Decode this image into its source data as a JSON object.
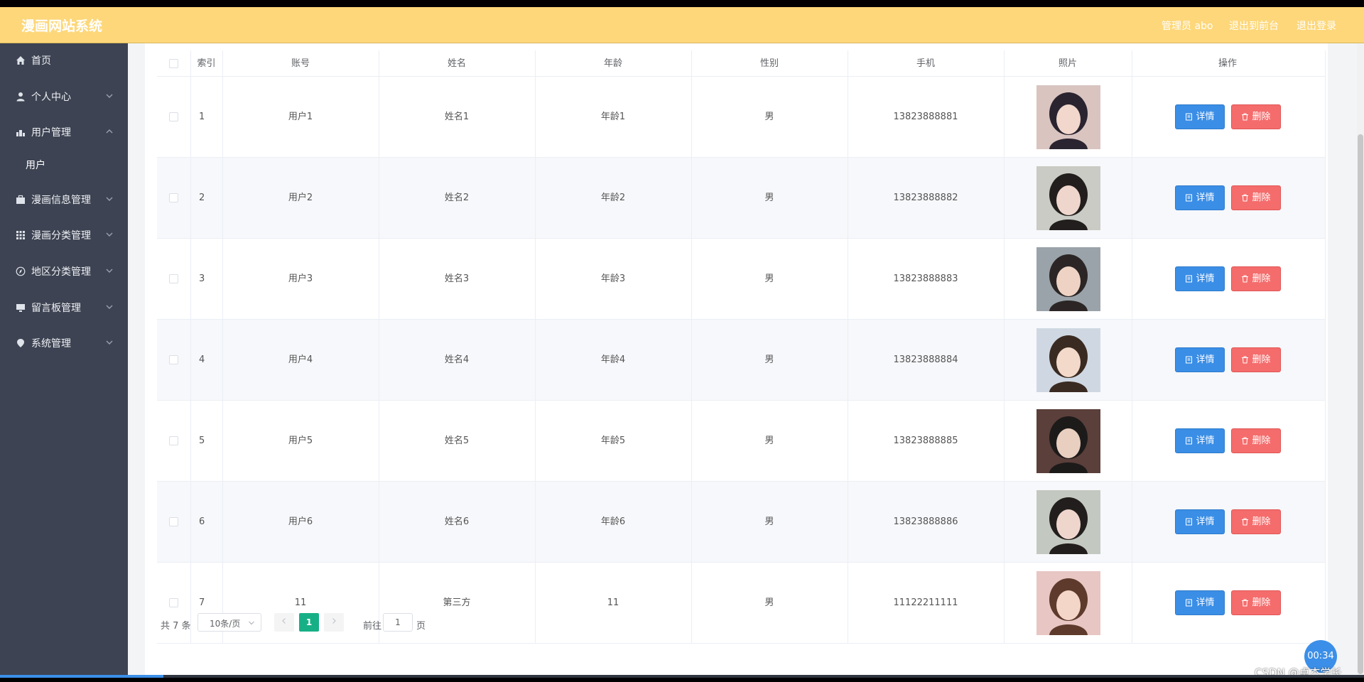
{
  "header": {
    "app_title": "漫画网站系统",
    "admin_label": "管理员 abo",
    "to_front": "退出到前台",
    "logout": "退出登录"
  },
  "sidebar": {
    "items": [
      {
        "label": "首页",
        "icon": "home-icon",
        "expanded": null
      },
      {
        "label": "个人中心",
        "icon": "person-icon",
        "expanded": false
      },
      {
        "label": "用户管理",
        "icon": "user-manage-icon",
        "expanded": true
      },
      {
        "label": "漫画信息管理",
        "icon": "briefcase-icon",
        "expanded": false
      },
      {
        "label": "漫画分类管理",
        "icon": "grid-icon",
        "expanded": false
      },
      {
        "label": "地区分类管理",
        "icon": "compass-icon",
        "expanded": false
      },
      {
        "label": "留言板管理",
        "icon": "monitor-icon",
        "expanded": false
      },
      {
        "label": "系统管理",
        "icon": "location-icon",
        "expanded": false
      }
    ],
    "sub_item": "用户"
  },
  "table": {
    "headers": [
      "索引",
      "账号",
      "姓名",
      "年龄",
      "性别",
      "手机",
      "照片",
      "操作"
    ],
    "detail_label": "详情",
    "delete_label": "删除",
    "rows": [
      {
        "index": "1",
        "account": "用户1",
        "name": "姓名1",
        "age": "年龄1",
        "gender": "男",
        "phone": "13823888881",
        "photo": "portrait-1"
      },
      {
        "index": "2",
        "account": "用户2",
        "name": "姓名2",
        "age": "年龄2",
        "gender": "男",
        "phone": "13823888882",
        "photo": "portrait-2"
      },
      {
        "index": "3",
        "account": "用户3",
        "name": "姓名3",
        "age": "年龄3",
        "gender": "男",
        "phone": "13823888883",
        "photo": "portrait-3"
      },
      {
        "index": "4",
        "account": "用户4",
        "name": "姓名4",
        "age": "年龄4",
        "gender": "男",
        "phone": "13823888884",
        "photo": "portrait-4"
      },
      {
        "index": "5",
        "account": "用户5",
        "name": "姓名5",
        "age": "年龄5",
        "gender": "男",
        "phone": "13823888885",
        "photo": "portrait-5"
      },
      {
        "index": "6",
        "account": "用户6",
        "name": "姓名6",
        "age": "年龄6",
        "gender": "男",
        "phone": "13823888886",
        "photo": "portrait-6"
      },
      {
        "index": "7",
        "account": "11",
        "name": "第三方",
        "age": "11",
        "gender": "男",
        "phone": "11122211111",
        "photo": "portrait-7"
      }
    ]
  },
  "pagination": {
    "total": "共 7 条",
    "page_size": "10条/页",
    "current": "1",
    "goto_prefix": "前往",
    "goto_value": "1",
    "goto_suffix": "页"
  },
  "overlay": {
    "timer": "00:34",
    "watermark": "CSDN @卓杰学长"
  },
  "colors": {
    "header_bg": "#fdd77a",
    "sidebar_bg": "#3d4352",
    "detail_btn": "#3a8ee6",
    "delete_btn": "#f56c6c",
    "page_active": "#17b086"
  },
  "video_progress": 0.12
}
